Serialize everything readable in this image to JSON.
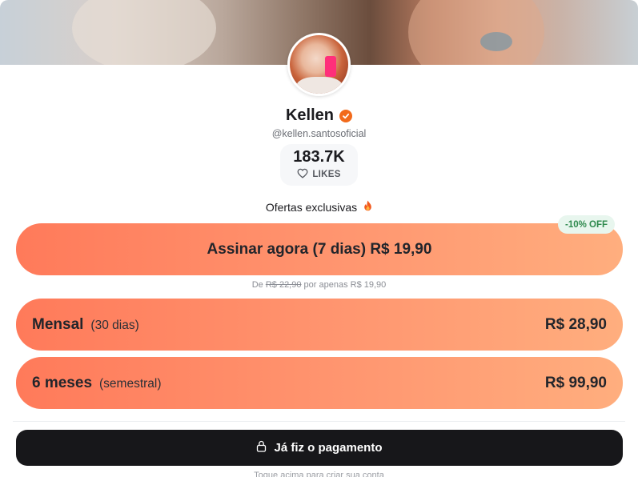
{
  "profile": {
    "name": "Kellen",
    "handle": "@kellen.santosoficial",
    "likes_count": "183.7K",
    "likes_label": "LIKES"
  },
  "offers": {
    "title": "Ofertas exclusivas",
    "discount_badge": "-10% OFF",
    "main_plan": {
      "label": "Assinar agora (7 dias) R$ 19,90"
    },
    "promo": {
      "prefix": "De",
      "old_price": "R$ 22,90",
      "suffix": "por apenas R$ 19,90"
    },
    "plans": [
      {
        "name": "Mensal",
        "period": "(30 dias)",
        "price": "R$ 28,90"
      },
      {
        "name": "6 meses",
        "period": "(semestral)",
        "price": "R$ 99,90"
      }
    ]
  },
  "actions": {
    "paid_button": "Já fiz o pagamento",
    "footer_hint": "Toque acima para criar sua conta"
  },
  "icons": {
    "verified": "verified-badge-icon",
    "likes": "heart-icon",
    "offers": "fire-icon",
    "paid": "lock-icon"
  },
  "colors": {
    "plan_gradient_start": "#ff7a5a",
    "plan_gradient_end": "#ffae7e",
    "verified_badge": "#f26a1b",
    "discount_bg": "#e8f6ee",
    "discount_text": "#2f8a4e",
    "button_bg": "#17171a"
  }
}
